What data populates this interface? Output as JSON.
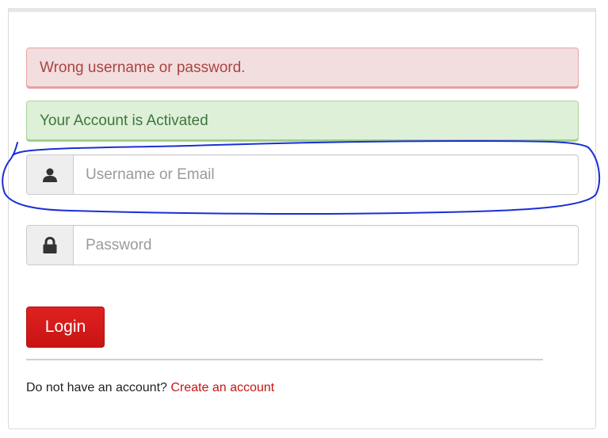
{
  "alerts": {
    "error": "Wrong username or password.",
    "success": "Your Account is Activated"
  },
  "form": {
    "username_placeholder": "Username or Email",
    "username_value": "",
    "password_placeholder": "Password",
    "password_value": "",
    "login_label": "Login"
  },
  "signup": {
    "prompt": "Do not have an account?",
    "link_label": "Create an account"
  },
  "icons": {
    "username": "user-icon",
    "password": "lock-icon"
  },
  "colors": {
    "accent": "#d61a1a",
    "error_bg": "#f2dede",
    "error_text": "#a94442",
    "success_bg": "#dff0d8",
    "success_text": "#3c763d",
    "annotation": "#1a2fd6"
  }
}
